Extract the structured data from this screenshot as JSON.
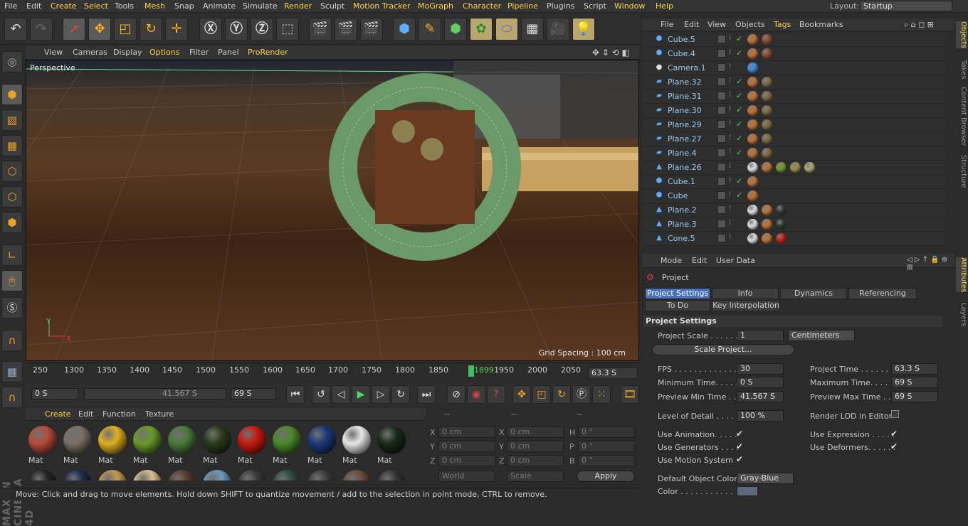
{
  "menubar": {
    "items": [
      "File",
      "Edit",
      "Create",
      "Select",
      "Tools",
      "Mesh",
      "Snap",
      "Animate",
      "Simulate",
      "Render",
      "Sculpt",
      "Motion Tracker",
      "MoGraph",
      "Character",
      "Pipeline",
      "Plugins",
      "Script",
      "Window",
      "Help"
    ],
    "layout_label": "Layout:",
    "layout_value": "Startup"
  },
  "viewport": {
    "menu": [
      "View",
      "Cameras",
      "Display",
      "Options",
      "Filter",
      "Panel",
      "ProRender"
    ],
    "label": "Perspective",
    "grid_spacing": "Grid Spacing : 100 cm",
    "axis_y": "Y",
    "axis_x": "X"
  },
  "timeline": {
    "ticks": [
      "250",
      "1300",
      "1350",
      "1400",
      "1450",
      "1500",
      "1550",
      "1600",
      "1650",
      "1700",
      "1750",
      "1800",
      "1850",
      "1899",
      "1950",
      "2000",
      "2050"
    ],
    "current_frame": "63.3 S"
  },
  "transport": {
    "start": "0 S",
    "range_value": "41.567 S",
    "end": "69 S"
  },
  "materials": {
    "menu": [
      "Create",
      "Edit",
      "Function",
      "Texture"
    ],
    "label": "Mat",
    "colors": [
      "#b84a3a",
      "#7a7064",
      "#e0b020",
      "#6a9a2a",
      "#4a7a3a",
      "#2a3a1a",
      "#c81a10",
      "#4a8a2a",
      "#1a3a7a",
      "#e8e8e8",
      "#1a2a1a"
    ],
    "row2_colors": [
      "#222",
      "#1a2a4a",
      "#c09a50",
      "#d8c090",
      "#5a3a2a",
      "#6a9ac0",
      "#3a3a3a",
      "#2a4a3a",
      "#3a3a3a",
      "#6a4a3a",
      "#333"
    ]
  },
  "coords": {
    "headers": [
      "--",
      "--",
      "--"
    ],
    "labels": [
      "X",
      "Y",
      "Z",
      "X",
      "Y",
      "Z",
      "H",
      "P",
      "B"
    ],
    "values": [
      "0 cm",
      "0 cm",
      "0 cm",
      "0 cm",
      "0 cm",
      "0 cm",
      "0 °",
      "0 °",
      "0 °"
    ],
    "world": "World",
    "scale": "Scale",
    "apply": "Apply"
  },
  "status": {
    "text": "Move: Click and drag to move elements. Hold down SHIFT to quantize movement / add to the selection in point mode, CTRL to remove."
  },
  "objects": {
    "menu": [
      "File",
      "Edit",
      "View",
      "Objects",
      "Tags",
      "Bookmarks"
    ],
    "rows": [
      {
        "name": "Cube.5",
        "type": "cube",
        "tags": [
          "#c07030",
          "#8a4a30"
        ]
      },
      {
        "name": "Cube.4",
        "type": "cube",
        "tags": [
          "#c07030",
          "#8a4a30"
        ]
      },
      {
        "name": "Camera.1",
        "type": "camera",
        "tags": [
          "#3a8ae0"
        ]
      },
      {
        "name": "Plane.32",
        "type": "plane",
        "tags": [
          "#c07030",
          "#7a6a40"
        ]
      },
      {
        "name": "Plane.31",
        "type": "plane",
        "tags": [
          "#c07030",
          "#7a6a40"
        ]
      },
      {
        "name": "Plane.30",
        "type": "plane",
        "tags": [
          "#c07030",
          "#7a6a40"
        ]
      },
      {
        "name": "Plane.29",
        "type": "plane",
        "tags": [
          "#c07030",
          "#7a6a40"
        ]
      },
      {
        "name": "Plane.27",
        "type": "plane",
        "tags": [
          "#c07030",
          "#7a6a40"
        ]
      },
      {
        "name": "Plane.4",
        "type": "plane",
        "tags": [
          "#c07030",
          "#7a6a40"
        ]
      },
      {
        "name": "Plane.26",
        "type": "mesh",
        "tags": [
          "#ddd",
          "#c07030",
          "#6a9a2a",
          "#a08a4a",
          "#b0a870"
        ]
      },
      {
        "name": "Cube.1",
        "type": "cube",
        "tags": [
          "#c07030"
        ]
      },
      {
        "name": "Cube",
        "type": "cube",
        "tags": [
          "#c07030"
        ]
      },
      {
        "name": "Plane.2",
        "type": "mesh",
        "tags": [
          "#ddd",
          "#c07030",
          "#2a3a2a"
        ]
      },
      {
        "name": "Plane.3",
        "type": "mesh",
        "tags": [
          "#ddd",
          "#c07030",
          "#2a3a2a"
        ]
      },
      {
        "name": "Cone.5",
        "type": "mesh",
        "tags": [
          "#ddd",
          "#c07030",
          "#c81a10"
        ]
      }
    ]
  },
  "side_tabs": [
    "Objects",
    "Takes",
    "Content Browser",
    "Structure",
    "Attributes",
    "Layers"
  ],
  "attributes": {
    "menu": [
      "Mode",
      "Edit",
      "User Data"
    ],
    "title": "Project",
    "tabs": [
      "Project Settings",
      "Info",
      "Dynamics",
      "Referencing",
      "To Do",
      "Key Interpolation"
    ],
    "section": "Project Settings",
    "project_scale_label": "Project Scale . . . . . .",
    "project_scale_value": "1",
    "units": "Centimeters",
    "scale_project_btn": "Scale Project...",
    "fps_label": "FPS . . . . . . . . . . . . . .",
    "fps_value": "30",
    "project_time_label": "Project Time . . . . . .",
    "project_time_value": "63.3 S",
    "min_time_label": "Minimum Time. . . . . .",
    "min_time_value": "0 S",
    "max_time_label": "Maximum Time. . . . . .",
    "max_time_value": "69 S",
    "preview_min_label": "Preview Min Time . . .",
    "preview_min_value": "41.567 S",
    "preview_max_label": "Preview Max Time . . .",
    "preview_max_value": "69 S",
    "lod_label": "Level of Detail . . . . .",
    "lod_value": "100 %",
    "render_lod_label": "Render LOD in Editor",
    "use_animation": "Use Animation. . . . .",
    "use_expression": "Use Expression . . . . .",
    "use_generators": "Use Generators . . . .",
    "use_deformers": "Use Deformers. . . . . .",
    "use_motion": "Use Motion System",
    "default_color_label": "Default Object Color",
    "default_color_value": "Gray-Blue",
    "color_label": "Color . . . . . . . . . . ."
  }
}
